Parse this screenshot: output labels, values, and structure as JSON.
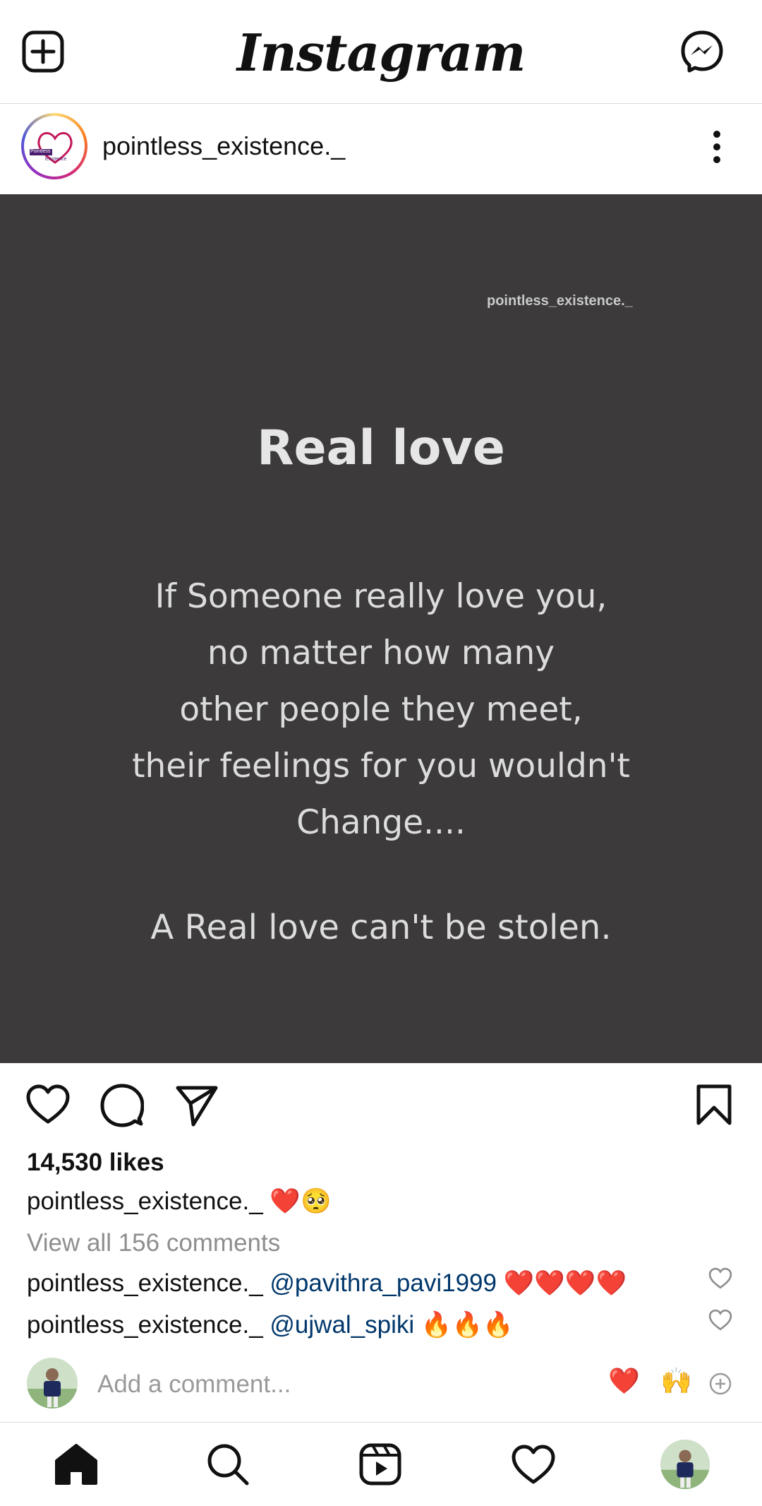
{
  "app": {
    "title": "Instagram"
  },
  "post": {
    "username": "pointless_existence._",
    "avatar_text_1": "Pointless",
    "avatar_text_2": "Existence",
    "image": {
      "watermark": "pointless_existence._",
      "title": "Real love",
      "body_lines": [
        "If Someone really love you,",
        "no matter how many",
        "other people they meet,",
        "their feelings for you wouldn't",
        "Change...."
      ],
      "ending": "A Real love can't be stolen."
    },
    "likes": "14,530 likes",
    "caption_user": "pointless_existence._",
    "caption_text": "❤️🥺",
    "view_all": "View all 156 comments",
    "comments": [
      {
        "user": "pointless_existence._",
        "mention": "@pavithra_pavi1999",
        "text": "❤️❤️❤️❤️"
      },
      {
        "user": "pointless_existence._",
        "mention": "@ujwal_spiki",
        "text": "🔥🔥🔥"
      }
    ],
    "add_comment_placeholder": "Add a comment...",
    "quick_reactions": [
      "❤️",
      "🙌"
    ]
  },
  "icons": {
    "new_post": "add-square-icon",
    "messenger": "messenger-icon",
    "more": "more-vertical-icon",
    "like": "heart-outline-icon",
    "comment": "comment-icon",
    "share": "send-icon",
    "save": "bookmark-icon",
    "nav": [
      "home-icon",
      "search-icon",
      "reels-icon",
      "heart-icon",
      "profile-avatar"
    ]
  },
  "colors": {
    "post_bg": "#3c3a3b",
    "mention": "#00376b",
    "muted": "#8e8e8e"
  }
}
